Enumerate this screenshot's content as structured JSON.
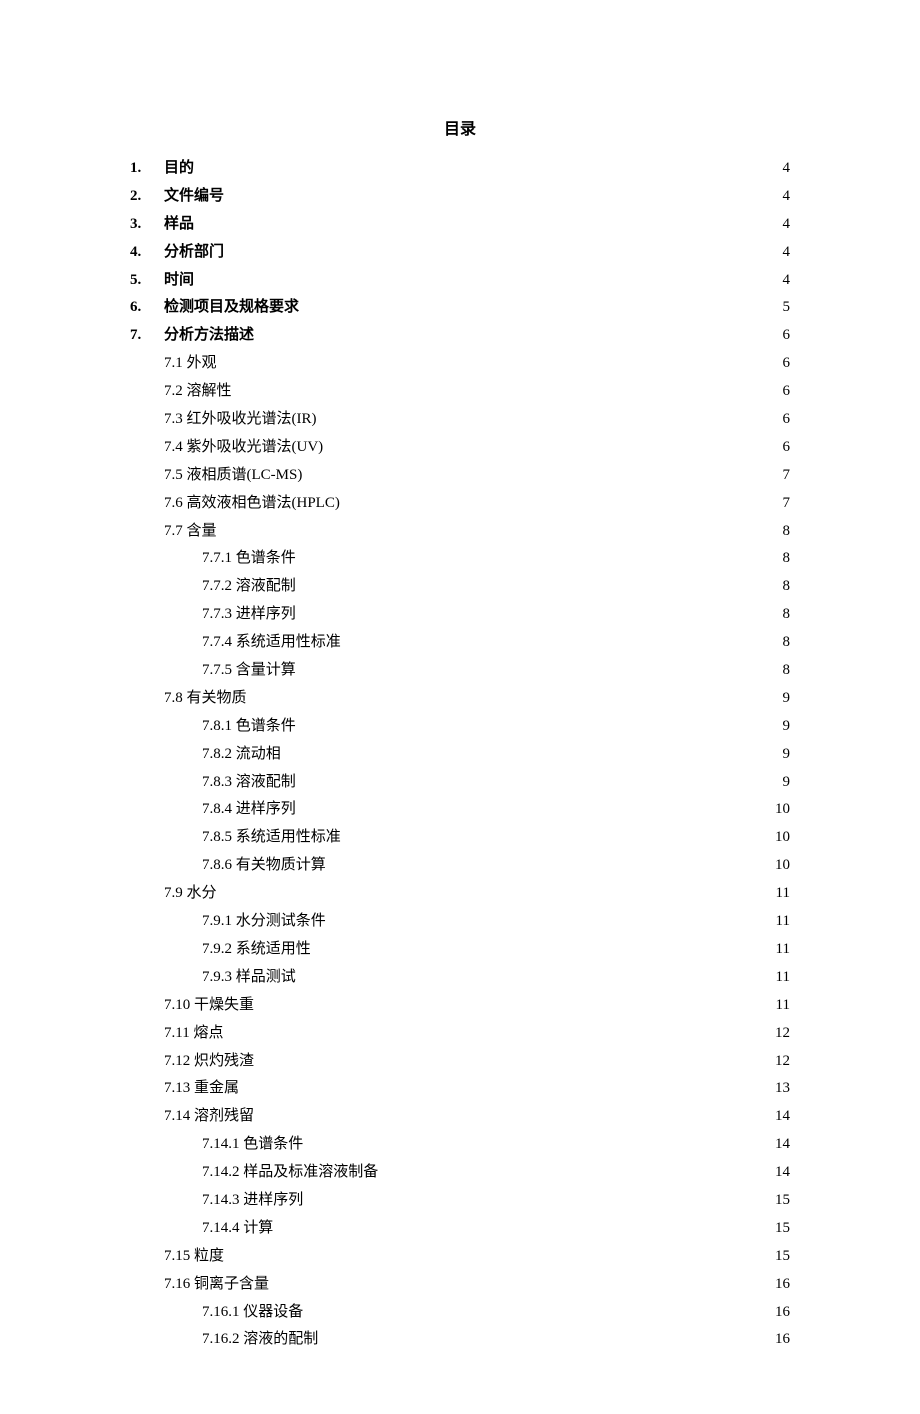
{
  "title": "目录",
  "entries": [
    {
      "num": "1.",
      "label": "目的",
      "page": "4",
      "level": 0,
      "bold": true
    },
    {
      "num": "2.",
      "label": "文件编号",
      "page": "4",
      "level": 0,
      "bold": true
    },
    {
      "num": "3.",
      "label": "样品",
      "page": "4",
      "level": 0,
      "bold": true
    },
    {
      "num": "4.",
      "label": "分析部门",
      "page": "4",
      "level": 0,
      "bold": true
    },
    {
      "num": "5.",
      "label": "时间",
      "page": "4",
      "level": 0,
      "bold": true
    },
    {
      "num": "6.",
      "label": "检测项目及规格要求",
      "page": "5",
      "level": 0,
      "bold": true
    },
    {
      "num": "7.",
      "label": "分析方法描述",
      "page": "6",
      "level": 0,
      "bold": true
    },
    {
      "num": "",
      "subnum": "7.1",
      "label": "外观",
      "page": "6",
      "level": 1
    },
    {
      "num": "",
      "subnum": "7.2",
      "label": "溶解性",
      "page": "6",
      "level": 1
    },
    {
      "num": "",
      "subnum": "7.3",
      "label": "红外吸收光谱法(IR)",
      "page": "6",
      "level": 1
    },
    {
      "num": "",
      "subnum": "7.4",
      "label": "紫外吸收光谱法(UV)",
      "page": "6",
      "level": 1
    },
    {
      "num": "",
      "subnum": "7.5",
      "label": "液相质谱(LC-MS)",
      "page": "7",
      "level": 1
    },
    {
      "num": "",
      "subnum": "7.6",
      "label": "高效液相色谱法(HPLC)",
      "page": "7",
      "level": 1
    },
    {
      "num": "",
      "subnum": "7.7",
      "label": "含量",
      "page": "8",
      "level": 1
    },
    {
      "num": "",
      "subnum": "7.7.1",
      "label": "色谱条件",
      "page": "8",
      "level": 2
    },
    {
      "num": "",
      "subnum": "7.7.2",
      "label": "溶液配制",
      "page": "8",
      "level": 2
    },
    {
      "num": "",
      "subnum": "7.7.3",
      "label": "进样序列",
      "page": "8",
      "level": 2
    },
    {
      "num": "",
      "subnum": "7.7.4",
      "label": "系统适用性标准",
      "page": "8",
      "level": 2
    },
    {
      "num": "",
      "subnum": "7.7.5",
      "label": "含量计算",
      "page": "8",
      "level": 2
    },
    {
      "num": "",
      "subnum": "7.8",
      "label": "有关物质",
      "page": "9",
      "level": 1
    },
    {
      "num": "",
      "subnum": "7.8.1",
      "label": "色谱条件",
      "page": "9",
      "level": 2
    },
    {
      "num": "",
      "subnum": "7.8.2",
      "label": "流动相",
      "page": "9",
      "level": 2
    },
    {
      "num": "",
      "subnum": "7.8.3",
      "label": "溶液配制",
      "page": "9",
      "level": 2
    },
    {
      "num": "",
      "subnum": "7.8.4",
      "label": "进样序列",
      "page": "10",
      "level": 2
    },
    {
      "num": "",
      "subnum": "7.8.5",
      "label": "系统适用性标准",
      "page": "10",
      "level": 2
    },
    {
      "num": "",
      "subnum": "7.8.6",
      "label": "有关物质计算",
      "page": "10",
      "level": 2
    },
    {
      "num": "",
      "subnum": "7.9",
      "label": "水分",
      "page": "11",
      "level": 1
    },
    {
      "num": "",
      "subnum": "7.9.1",
      "label": "水分测试条件",
      "page": "11",
      "level": 2
    },
    {
      "num": "",
      "subnum": "7.9.2",
      "label": "系统适用性",
      "page": "11",
      "level": 2
    },
    {
      "num": "",
      "subnum": "7.9.3",
      "label": "样品测试",
      "page": "11",
      "level": 2
    },
    {
      "num": "",
      "subnum": "7.10",
      "label": "干燥失重",
      "page": "11",
      "level": 1
    },
    {
      "num": "",
      "subnum": "7.11",
      "label": "熔点",
      "page": "12",
      "level": 1
    },
    {
      "num": "",
      "subnum": "7.12",
      "label": "炽灼残渣",
      "page": "12",
      "level": 1
    },
    {
      "num": "",
      "subnum": "7.13",
      "label": "重金属",
      "page": "13",
      "level": 1
    },
    {
      "num": "",
      "subnum": "7.14",
      "label": "溶剂残留",
      "page": "14",
      "level": 1
    },
    {
      "num": "",
      "subnum": "7.14.1",
      "label": "色谱条件",
      "page": "14",
      "level": 2
    },
    {
      "num": "",
      "subnum": "7.14.2",
      "label": "样品及标准溶液制备",
      "page": "14",
      "level": 2
    },
    {
      "num": "",
      "subnum": "7.14.3",
      "label": "进样序列",
      "page": "15",
      "level": 2
    },
    {
      "num": "",
      "subnum": "7.14.4",
      "label": "计算",
      "page": "15",
      "level": 2
    },
    {
      "num": "",
      "subnum": "7.15",
      "label": "粒度",
      "page": "15",
      "level": 1
    },
    {
      "num": "",
      "subnum": "7.16",
      "label": "铜离子含量",
      "page": "16",
      "level": 1
    },
    {
      "num": "",
      "subnum": "7.16.1",
      "label": "仪器设备",
      "page": "16",
      "level": 2
    },
    {
      "num": "",
      "subnum": "7.16.2",
      "label": "溶液的配制",
      "page": "16",
      "level": 2
    }
  ]
}
